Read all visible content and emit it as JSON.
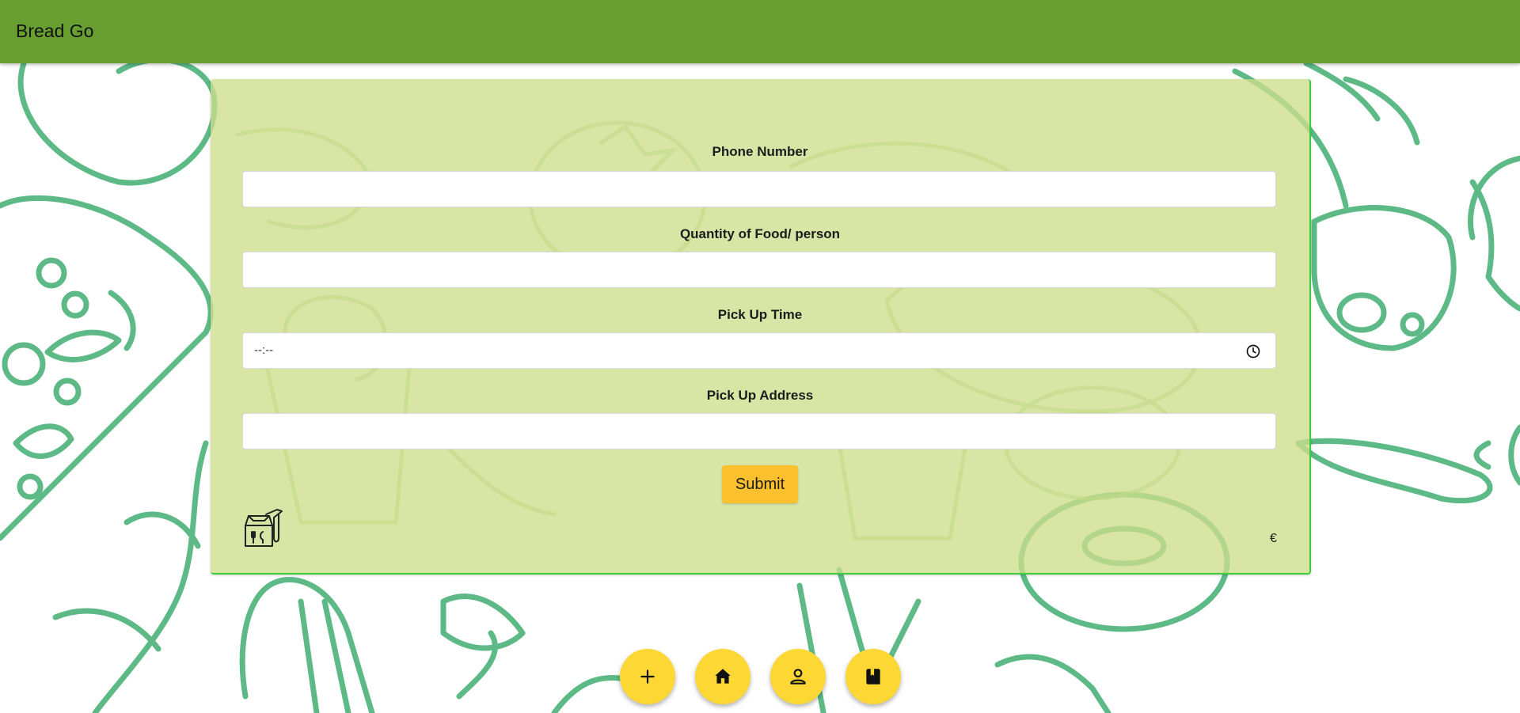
{
  "app": {
    "title": "Bread Go"
  },
  "form": {
    "phone_label": "Phone Number",
    "phone_value": "",
    "quantity_label": "Quantity of Food/ person",
    "quantity_value": "",
    "time_label": "Pick Up Time",
    "time_value": "--:--",
    "address_label": "Pick Up Address",
    "address_value": "",
    "submit_label": "Submit",
    "currency_mark": "€"
  },
  "fabs": [
    {
      "icon": "plus-icon"
    },
    {
      "icon": "home-icon"
    },
    {
      "icon": "person-icon"
    },
    {
      "icon": "book-icon"
    }
  ],
  "colors": {
    "appbar": "#689f30",
    "card": "#cdde8c",
    "accent": "#fbc02d",
    "fab": "#fdd835",
    "doodle": "#4caf7d"
  }
}
